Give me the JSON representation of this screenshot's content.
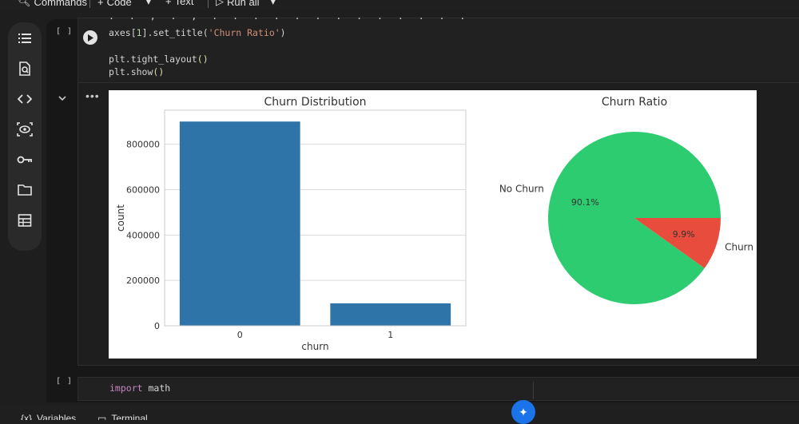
{
  "toolbar": {
    "commands_label": "Commands",
    "code_label": "Code",
    "text_label": "Text",
    "run_all_label": "Run all"
  },
  "sidebar": {
    "items": [
      {
        "icon": "table-of-contents-icon"
      },
      {
        "icon": "find-icon"
      },
      {
        "icon": "code-snippets-icon"
      },
      {
        "icon": "variables-inspector-icon"
      },
      {
        "icon": "secrets-key-icon"
      },
      {
        "icon": "files-folder-icon"
      },
      {
        "icon": "data-table-icon"
      }
    ]
  },
  "cell1": {
    "exec_count": "[ ]",
    "lines": [
      {
        "parts": [
          {
            "t": "axes[",
            "c": ""
          },
          {
            "t": "1",
            "c": "num"
          },
          {
            "t": "].set_title(",
            "c": ""
          },
          {
            "t": "'Churn Ratio'",
            "c": "str"
          },
          {
            "t": ")",
            "c": ""
          }
        ]
      },
      {
        "parts": [
          {
            "t": "plt.tight_layout",
            "c": ""
          },
          {
            "t": "()",
            "c": "fn"
          }
        ]
      },
      {
        "parts": [
          {
            "t": "plt.show",
            "c": ""
          },
          {
            "t": "()",
            "c": "fn"
          }
        ]
      }
    ]
  },
  "output": {
    "more_label": "•••"
  },
  "chart_data": [
    {
      "type": "bar",
      "title": "Churn Distribution",
      "xlabel": "churn",
      "ylabel": "count",
      "categories": [
        "0",
        "1"
      ],
      "values": [
        900000,
        99000
      ],
      "ylim": [
        0,
        950000
      ],
      "yticks": [
        0,
        200000,
        400000,
        600000,
        800000
      ],
      "ytick_labels": [
        "0",
        "200000",
        "400000",
        "600000",
        "800000"
      ],
      "grid": true,
      "color": "#2f74a8"
    },
    {
      "type": "pie",
      "title": "Churn Ratio",
      "labels": [
        "No Churn",
        "Churn"
      ],
      "values": [
        90.1,
        9.9
      ],
      "value_labels": [
        "90.1%",
        "9.9%"
      ],
      "colors": [
        "#2ecc71",
        "#e74c3c"
      ]
    }
  ],
  "cell2": {
    "exec_count": "[ ]",
    "line1_kw": "import",
    "line1_rest": " math"
  },
  "bottombar": {
    "variables_label": "Variables",
    "terminal_label": "Terminal"
  }
}
